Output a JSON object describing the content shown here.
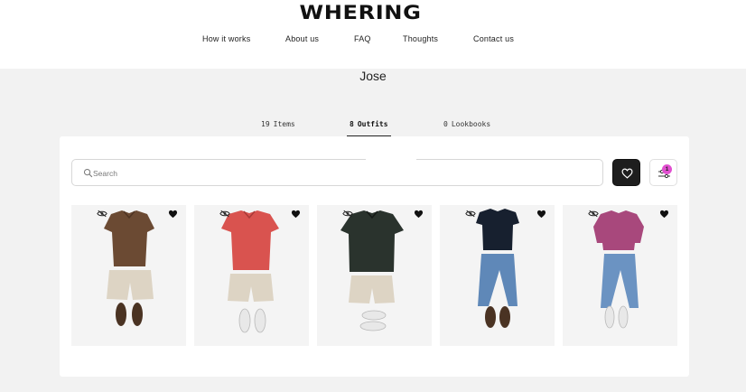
{
  "brand": {
    "logo": "WHERING"
  },
  "nav": [
    {
      "label": "How it works"
    },
    {
      "label": "About us"
    },
    {
      "label": "FAQ"
    },
    {
      "label": "Thoughts"
    },
    {
      "label": "Contact us"
    }
  ],
  "profile": {
    "name": "Jose"
  },
  "tabs": [
    {
      "count": "19",
      "label": "Items",
      "active": false
    },
    {
      "count": "8",
      "label": "Outfits",
      "active": true
    },
    {
      "count": "0",
      "label": "Lookbooks",
      "active": false
    }
  ],
  "search": {
    "placeholder": "Search",
    "value": ""
  },
  "filter": {
    "badge_count": "1"
  },
  "colors": {
    "badge": "#e14fd0",
    "dark_button": "#1e1e1e"
  },
  "outfits": [
    {
      "top": "brown polo shirt",
      "bottom": "beige shorts",
      "shoes": "brown loafers",
      "top_color": "#6b4a33",
      "bottom_color": "#ddd4c4",
      "shoe_color": "#4a3323"
    },
    {
      "top": "red polo shirt",
      "bottom": "beige shorts",
      "shoes": "white sneakers",
      "top_color": "#d9534f",
      "bottom_color": "#ddd4c4",
      "shoe_color": "#e8e8e8"
    },
    {
      "top": "dark green polo shirt",
      "bottom": "beige shorts",
      "shoes": "white sneakers",
      "top_color": "#2a332d",
      "bottom_color": "#ddd4c4",
      "shoe_color": "#e8e8e8"
    },
    {
      "top": "navy t-shirt",
      "bottom": "blue jeans",
      "shoes": "brown loafers",
      "top_color": "#17202f",
      "bottom_color": "#5f88b8",
      "shoe_color": "#4a3323"
    },
    {
      "top": "magenta long-sleeve shirt",
      "bottom": "blue jeans",
      "shoes": "white sneakers",
      "top_color": "#a8487c",
      "bottom_color": "#6b93c2",
      "shoe_color": "#e8e8e8"
    }
  ]
}
